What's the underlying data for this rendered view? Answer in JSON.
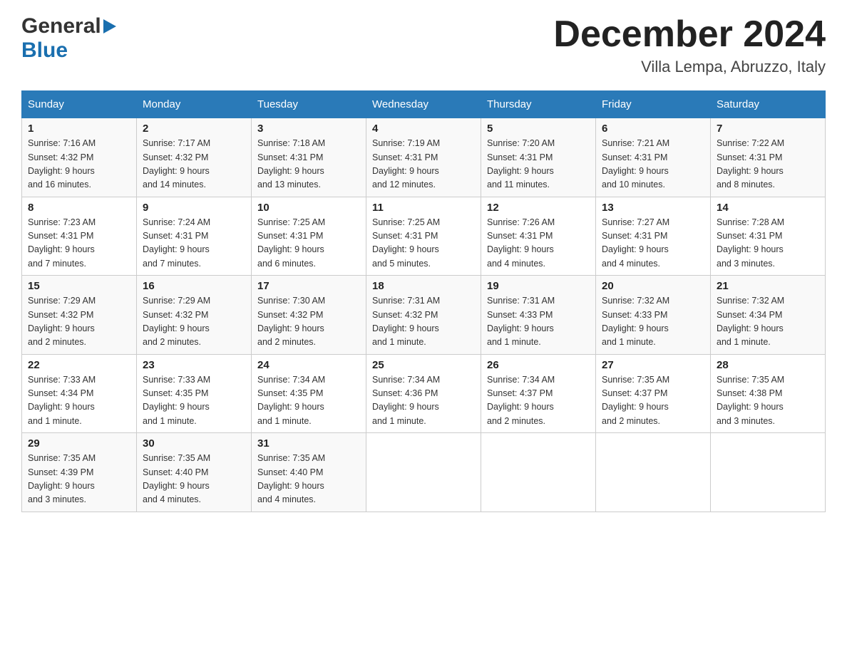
{
  "header": {
    "logo_general": "General",
    "logo_blue": "Blue",
    "month_title": "December 2024",
    "location": "Villa Lempa, Abruzzo, Italy"
  },
  "weekdays": [
    "Sunday",
    "Monday",
    "Tuesday",
    "Wednesday",
    "Thursday",
    "Friday",
    "Saturday"
  ],
  "weeks": [
    [
      {
        "day": "1",
        "sunrise": "7:16 AM",
        "sunset": "4:32 PM",
        "daylight": "9 hours and 16 minutes."
      },
      {
        "day": "2",
        "sunrise": "7:17 AM",
        "sunset": "4:32 PM",
        "daylight": "9 hours and 14 minutes."
      },
      {
        "day": "3",
        "sunrise": "7:18 AM",
        "sunset": "4:31 PM",
        "daylight": "9 hours and 13 minutes."
      },
      {
        "day": "4",
        "sunrise": "7:19 AM",
        "sunset": "4:31 PM",
        "daylight": "9 hours and 12 minutes."
      },
      {
        "day": "5",
        "sunrise": "7:20 AM",
        "sunset": "4:31 PM",
        "daylight": "9 hours and 11 minutes."
      },
      {
        "day": "6",
        "sunrise": "7:21 AM",
        "sunset": "4:31 PM",
        "daylight": "9 hours and 10 minutes."
      },
      {
        "day": "7",
        "sunrise": "7:22 AM",
        "sunset": "4:31 PM",
        "daylight": "9 hours and 8 minutes."
      }
    ],
    [
      {
        "day": "8",
        "sunrise": "7:23 AM",
        "sunset": "4:31 PM",
        "daylight": "9 hours and 7 minutes."
      },
      {
        "day": "9",
        "sunrise": "7:24 AM",
        "sunset": "4:31 PM",
        "daylight": "9 hours and 7 minutes."
      },
      {
        "day": "10",
        "sunrise": "7:25 AM",
        "sunset": "4:31 PM",
        "daylight": "9 hours and 6 minutes."
      },
      {
        "day": "11",
        "sunrise": "7:25 AM",
        "sunset": "4:31 PM",
        "daylight": "9 hours and 5 minutes."
      },
      {
        "day": "12",
        "sunrise": "7:26 AM",
        "sunset": "4:31 PM",
        "daylight": "9 hours and 4 minutes."
      },
      {
        "day": "13",
        "sunrise": "7:27 AM",
        "sunset": "4:31 PM",
        "daylight": "9 hours and 4 minutes."
      },
      {
        "day": "14",
        "sunrise": "7:28 AM",
        "sunset": "4:31 PM",
        "daylight": "9 hours and 3 minutes."
      }
    ],
    [
      {
        "day": "15",
        "sunrise": "7:29 AM",
        "sunset": "4:32 PM",
        "daylight": "9 hours and 2 minutes."
      },
      {
        "day": "16",
        "sunrise": "7:29 AM",
        "sunset": "4:32 PM",
        "daylight": "9 hours and 2 minutes."
      },
      {
        "day": "17",
        "sunrise": "7:30 AM",
        "sunset": "4:32 PM",
        "daylight": "9 hours and 2 minutes."
      },
      {
        "day": "18",
        "sunrise": "7:31 AM",
        "sunset": "4:32 PM",
        "daylight": "9 hours and 1 minute."
      },
      {
        "day": "19",
        "sunrise": "7:31 AM",
        "sunset": "4:33 PM",
        "daylight": "9 hours and 1 minute."
      },
      {
        "day": "20",
        "sunrise": "7:32 AM",
        "sunset": "4:33 PM",
        "daylight": "9 hours and 1 minute."
      },
      {
        "day": "21",
        "sunrise": "7:32 AM",
        "sunset": "4:34 PM",
        "daylight": "9 hours and 1 minute."
      }
    ],
    [
      {
        "day": "22",
        "sunrise": "7:33 AM",
        "sunset": "4:34 PM",
        "daylight": "9 hours and 1 minute."
      },
      {
        "day": "23",
        "sunrise": "7:33 AM",
        "sunset": "4:35 PM",
        "daylight": "9 hours and 1 minute."
      },
      {
        "day": "24",
        "sunrise": "7:34 AM",
        "sunset": "4:35 PM",
        "daylight": "9 hours and 1 minute."
      },
      {
        "day": "25",
        "sunrise": "7:34 AM",
        "sunset": "4:36 PM",
        "daylight": "9 hours and 1 minute."
      },
      {
        "day": "26",
        "sunrise": "7:34 AM",
        "sunset": "4:37 PM",
        "daylight": "9 hours and 2 minutes."
      },
      {
        "day": "27",
        "sunrise": "7:35 AM",
        "sunset": "4:37 PM",
        "daylight": "9 hours and 2 minutes."
      },
      {
        "day": "28",
        "sunrise": "7:35 AM",
        "sunset": "4:38 PM",
        "daylight": "9 hours and 3 minutes."
      }
    ],
    [
      {
        "day": "29",
        "sunrise": "7:35 AM",
        "sunset": "4:39 PM",
        "daylight": "9 hours and 3 minutes."
      },
      {
        "day": "30",
        "sunrise": "7:35 AM",
        "sunset": "4:40 PM",
        "daylight": "9 hours and 4 minutes."
      },
      {
        "day": "31",
        "sunrise": "7:35 AM",
        "sunset": "4:40 PM",
        "daylight": "9 hours and 4 minutes."
      },
      null,
      null,
      null,
      null
    ]
  ],
  "labels": {
    "sunrise": "Sunrise:",
    "sunset": "Sunset:",
    "daylight": "Daylight:"
  }
}
